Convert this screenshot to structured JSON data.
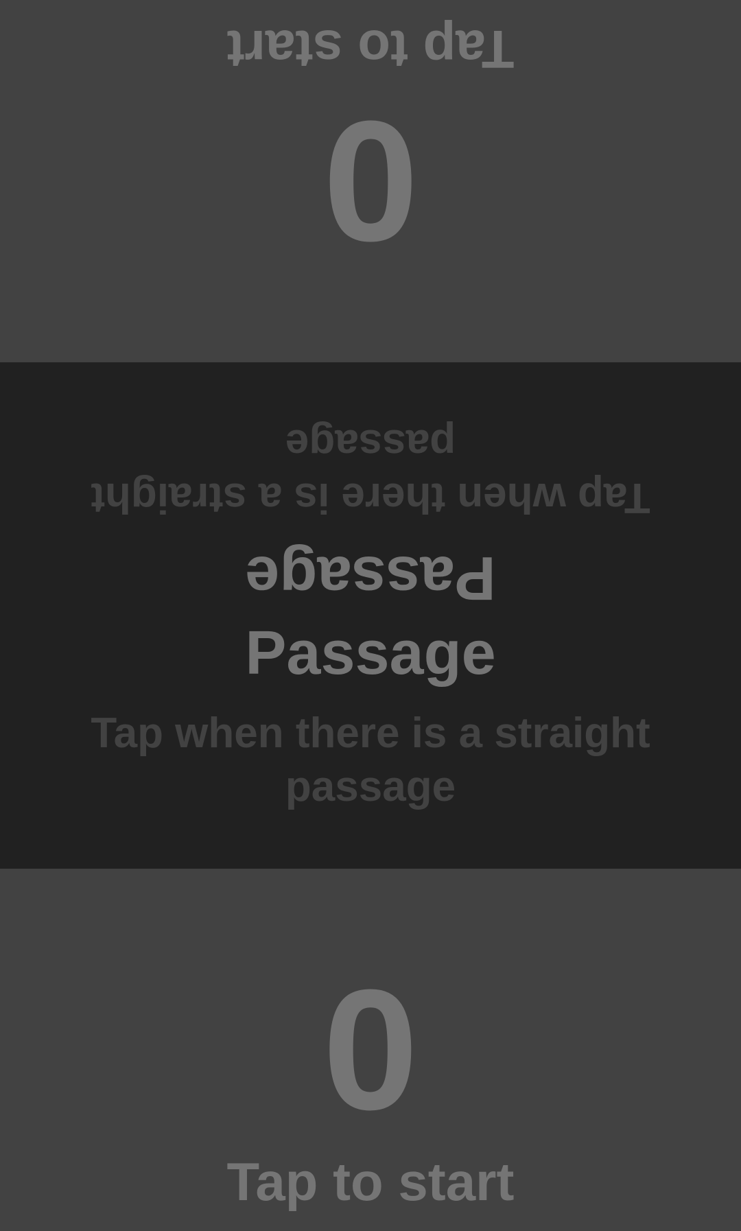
{
  "top_player": {
    "score": "0",
    "hint": "Tap to start"
  },
  "bottom_player": {
    "score": "0",
    "hint": "Tap to start"
  },
  "card": {
    "title": "Passage",
    "description": "Tap when there is a straight passage"
  },
  "colors": {
    "panel_background": "#424242",
    "center_background": "#212121",
    "primary_text": "#757575",
    "secondary_text": "#424242"
  }
}
